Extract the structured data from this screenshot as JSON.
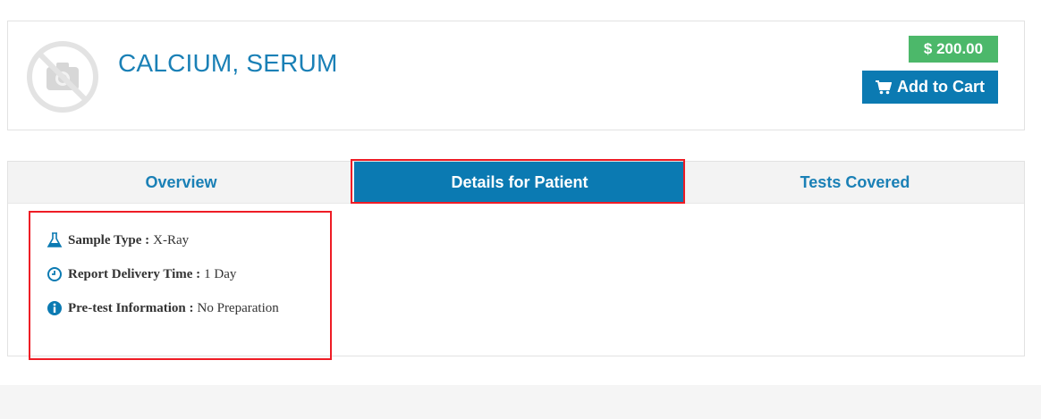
{
  "product": {
    "title": "CALCIUM, SERUM",
    "price": "$ 200.00",
    "add_to_cart_label": "Add to Cart"
  },
  "tabs": [
    {
      "label": "Overview",
      "active": false
    },
    {
      "label": "Details for Patient",
      "active": true
    },
    {
      "label": "Tests Covered",
      "active": false
    }
  ],
  "details": [
    {
      "icon": "flask-icon",
      "label": "Sample Type :",
      "value": "X-Ray"
    },
    {
      "icon": "clock-icon",
      "label": "Report Delivery Time :",
      "value": "1 Day"
    },
    {
      "icon": "info-icon",
      "label": "Pre-test Information :",
      "value": "No Preparation"
    }
  ],
  "colors": {
    "accent": "#0b7ab2",
    "price_badge": "#4cb86a",
    "highlight": "#ee1c25"
  }
}
